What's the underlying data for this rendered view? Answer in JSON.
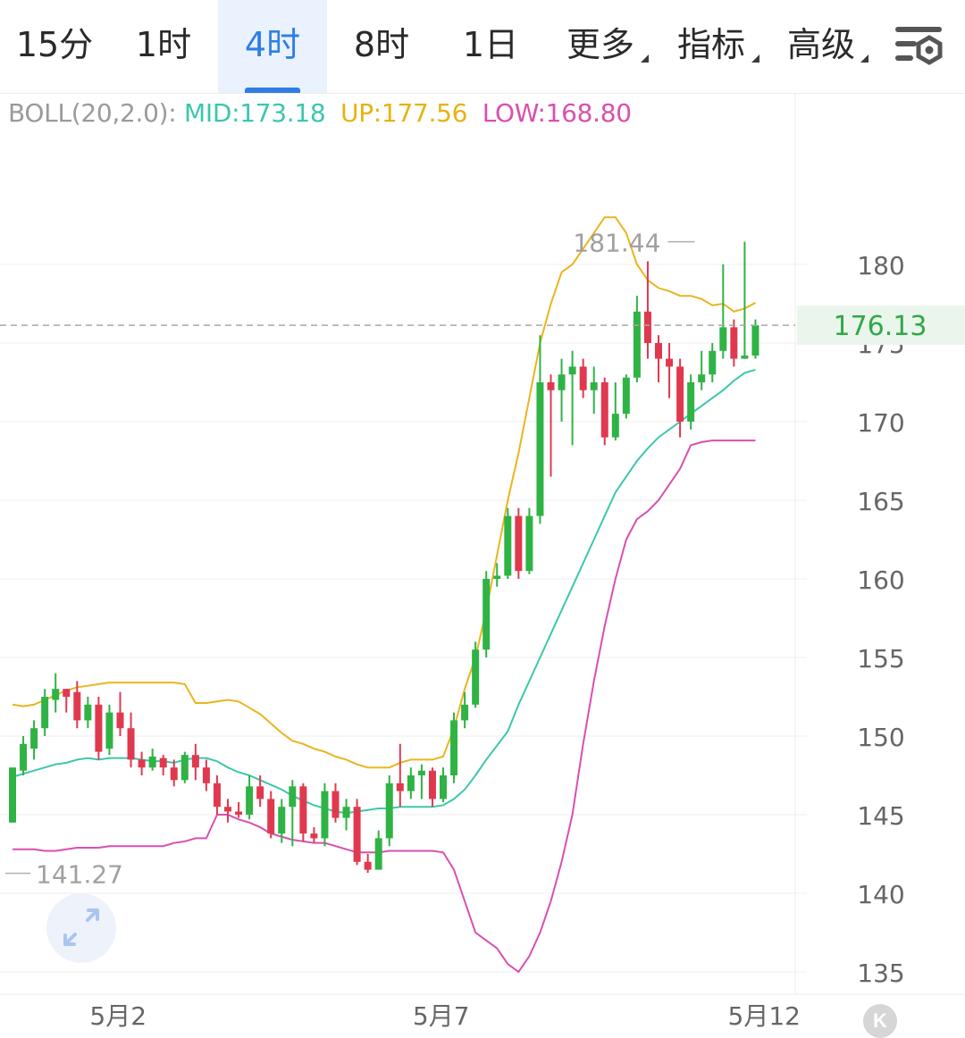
{
  "toolbar": {
    "tabs": [
      {
        "label": "15分",
        "active": false
      },
      {
        "label": "1时",
        "active": false
      },
      {
        "label": "4时",
        "active": true
      },
      {
        "label": "8时",
        "active": false
      },
      {
        "label": "1日",
        "active": false
      },
      {
        "label": "更多",
        "active": false,
        "dropdown": true
      },
      {
        "label": "指标",
        "active": false,
        "dropdown": true
      },
      {
        "label": "高级",
        "active": false,
        "dropdown": true
      }
    ],
    "settings_icon": "chart-settings-icon"
  },
  "legend": {
    "prefix": "BOLL(20,2.0):",
    "mid": "MID:173.18",
    "up": "UP:177.56",
    "low": "LOW:168.80"
  },
  "colors": {
    "up_candle": "#2fb344",
    "down_candle": "#e0394f",
    "mid_line": "#3cc7ac",
    "upper_band": "#eab51e",
    "lower_band": "#d94fb0",
    "active_tab": "#2f7ee6",
    "last_price": "#2fa84a",
    "axis_text": "#666666"
  },
  "chart_data": {
    "type": "candlestick",
    "indicator": "BOLL(20,2.0)",
    "ylim": [
      134,
      185
    ],
    "y_ticks": [
      135,
      140,
      145,
      150,
      155,
      160,
      165,
      170,
      175,
      180
    ],
    "x_ticks": [
      {
        "label": "5月2",
        "index": 5
      },
      {
        "label": "5月7",
        "index": 35
      },
      {
        "label": "5月12",
        "index": 65
      }
    ],
    "last_price": "176.13",
    "max_label": "181.44",
    "min_label": "141.27",
    "candles": [
      [
        144.5,
        148.0,
        148.0,
        144.5
      ],
      [
        147.8,
        149.5,
        150.0,
        147.5
      ],
      [
        149.2,
        150.5,
        151.0,
        148.5
      ],
      [
        150.5,
        152.5,
        153.0,
        150.0
      ],
      [
        152.3,
        153.0,
        154.0,
        151.5
      ],
      [
        153.0,
        152.5,
        153.0,
        151.5
      ],
      [
        152.8,
        151.0,
        153.5,
        150.5
      ],
      [
        151.0,
        152.0,
        152.5,
        150.5
      ],
      [
        152.0,
        149.0,
        152.5,
        148.5
      ],
      [
        149.2,
        151.5,
        152.0,
        148.8
      ],
      [
        151.5,
        150.5,
        152.8,
        150.0
      ],
      [
        150.5,
        148.5,
        151.5,
        148.0
      ],
      [
        148.5,
        148.0,
        149.0,
        147.5
      ],
      [
        148.0,
        148.7,
        149.2,
        147.8
      ],
      [
        148.6,
        148.0,
        148.8,
        147.5
      ],
      [
        148.0,
        147.2,
        148.5,
        146.8
      ],
      [
        147.2,
        148.8,
        149.0,
        147.0
      ],
      [
        148.8,
        148.0,
        149.5,
        147.2
      ],
      [
        148.0,
        147.0,
        148.5,
        146.5
      ],
      [
        147.0,
        145.5,
        147.5,
        145.0
      ],
      [
        145.5,
        145.2,
        146.0,
        144.5
      ],
      [
        145.2,
        145.0,
        145.8,
        144.8
      ],
      [
        145.0,
        146.8,
        147.5,
        144.7
      ],
      [
        146.8,
        146.0,
        147.5,
        145.5
      ],
      [
        146.0,
        143.8,
        146.5,
        143.5
      ],
      [
        143.8,
        145.5,
        146.0,
        143.2
      ],
      [
        145.5,
        146.8,
        147.2,
        143.0
      ],
      [
        146.8,
        143.8,
        147.0,
        143.3
      ],
      [
        143.8,
        143.5,
        144.2,
        143.2
      ],
      [
        143.5,
        146.5,
        147.0,
        143.0
      ],
      [
        146.5,
        144.8,
        147.0,
        144.5
      ],
      [
        144.8,
        145.5,
        146.0,
        144.0
      ],
      [
        145.5,
        142.0,
        146.0,
        141.8
      ],
      [
        142.0,
        141.5,
        142.5,
        141.3
      ],
      [
        141.5,
        143.5,
        144.0,
        141.5
      ],
      [
        143.5,
        147.0,
        147.5,
        143.0
      ],
      [
        147.0,
        146.5,
        149.5,
        145.5
      ],
      [
        146.5,
        147.5,
        148.0,
        146.0
      ],
      [
        147.5,
        147.8,
        148.2,
        146.0
      ],
      [
        147.8,
        146.0,
        148.0,
        145.5
      ],
      [
        146.0,
        147.5,
        148.0,
        145.8
      ],
      [
        147.5,
        151.0,
        151.5,
        147.0
      ],
      [
        151.0,
        152.0,
        152.8,
        150.5
      ],
      [
        152.0,
        155.5,
        156.0,
        151.8
      ],
      [
        155.5,
        160.0,
        160.5,
        155.0
      ],
      [
        160.0,
        160.2,
        161.0,
        159.5
      ],
      [
        160.2,
        164.0,
        164.5,
        160.0
      ],
      [
        164.0,
        160.5,
        164.5,
        160.0
      ],
      [
        160.5,
        164.0,
        164.5,
        160.3
      ],
      [
        164.0,
        172.5,
        175.5,
        163.5
      ],
      [
        172.5,
        172.0,
        173.0,
        166.5
      ],
      [
        172.0,
        173.0,
        174.0,
        170.0
      ],
      [
        173.0,
        173.5,
        174.5,
        168.5
      ],
      [
        173.5,
        172.0,
        174.0,
        171.5
      ],
      [
        172.0,
        172.5,
        173.5,
        170.5
      ],
      [
        172.5,
        169.0,
        172.8,
        168.5
      ],
      [
        169.0,
        170.5,
        172.5,
        168.8
      ],
      [
        170.5,
        172.8,
        173.0,
        170.2
      ],
      [
        172.8,
        177.0,
        178.0,
        172.5
      ],
      [
        177.0,
        175.0,
        180.2,
        174.0
      ],
      [
        175.0,
        174.0,
        175.5,
        172.5
      ],
      [
        174.0,
        173.5,
        175.0,
        171.5
      ],
      [
        173.5,
        170.0,
        174.0,
        169.0
      ],
      [
        170.0,
        172.5,
        173.0,
        169.5
      ],
      [
        172.5,
        173.0,
        174.5,
        172.0
      ],
      [
        173.0,
        174.5,
        175.0,
        172.5
      ],
      [
        174.5,
        176.0,
        180.0,
        174.0
      ],
      [
        176.0,
        174.0,
        176.5,
        173.5
      ],
      [
        174.0,
        174.2,
        181.44,
        174.0
      ],
      [
        174.2,
        176.13,
        176.5,
        174.0
      ]
    ],
    "bands": {
      "mid": [
        147.4,
        147.6,
        147.8,
        148.0,
        148.2,
        148.3,
        148.5,
        148.6,
        148.5,
        148.6,
        148.6,
        148.6,
        148.5,
        148.4,
        148.4,
        148.3,
        148.5,
        148.6,
        148.6,
        148.4,
        148.0,
        147.7,
        147.5,
        147.2,
        146.9,
        146.6,
        146.2,
        145.9,
        145.6,
        145.4,
        145.2,
        145.1,
        145.2,
        145.3,
        145.4,
        145.4,
        145.5,
        145.5,
        145.5,
        145.5,
        145.6,
        146.0,
        146.6,
        147.5,
        148.5,
        149.4,
        150.3,
        152.0,
        153.5,
        155.0,
        156.5,
        158.0,
        159.5,
        161.0,
        162.5,
        164.0,
        165.5,
        166.5,
        167.5,
        168.3,
        169.0,
        169.5,
        170.0,
        170.5,
        171.0,
        171.5,
        172.0,
        172.6,
        173.1,
        173.3
      ],
      "up": [
        152.0,
        151.9,
        152.0,
        152.3,
        152.6,
        152.9,
        153.1,
        153.2,
        153.3,
        153.4,
        153.4,
        153.4,
        153.4,
        153.4,
        153.4,
        153.4,
        153.3,
        152.1,
        152.1,
        152.2,
        152.3,
        152.2,
        151.8,
        151.4,
        150.8,
        150.2,
        149.7,
        149.5,
        149.2,
        149.0,
        148.7,
        148.5,
        148.2,
        148.0,
        148.0,
        148.0,
        148.3,
        148.5,
        148.5,
        148.5,
        148.7,
        150.5,
        153.0,
        155.0,
        158.0,
        161.5,
        165.0,
        168.0,
        171.5,
        175.0,
        177.5,
        179.5,
        180.0,
        181.0,
        182.0,
        183.0,
        183.0,
        182.0,
        180.0,
        179.0,
        178.5,
        178.3,
        178.0,
        178.0,
        177.8,
        177.4,
        177.5,
        177.0,
        177.2,
        177.56
      ],
      "low": [
        142.8,
        142.8,
        142.8,
        142.7,
        142.7,
        142.8,
        142.9,
        142.9,
        142.9,
        143.0,
        143.0,
        143.0,
        143.0,
        143.0,
        143.0,
        143.2,
        143.3,
        143.5,
        143.5,
        145.0,
        145.0,
        144.7,
        144.5,
        144.2,
        143.8,
        143.6,
        143.4,
        143.3,
        143.2,
        143.2,
        143.0,
        142.8,
        142.6,
        142.6,
        142.6,
        142.7,
        142.7,
        142.7,
        142.7,
        142.7,
        142.6,
        141.5,
        139.5,
        137.5,
        137.0,
        136.5,
        135.5,
        135.0,
        136.0,
        137.5,
        139.5,
        142.0,
        145.0,
        149.5,
        153.5,
        157.0,
        160.0,
        162.5,
        163.8,
        164.3,
        165.0,
        166.0,
        167.0,
        168.5,
        168.7,
        168.8,
        168.8,
        168.8,
        168.8,
        168.8
      ]
    }
  }
}
